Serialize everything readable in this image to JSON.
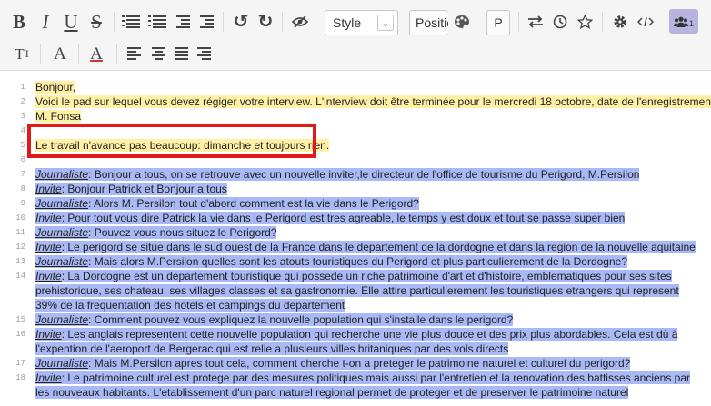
{
  "toolbar": {
    "row1": {
      "bold": "B",
      "italic": "I",
      "underline": "U",
      "strike": "S",
      "undo": "↺",
      "redo": "↻",
      "style_select": "Style",
      "style_arrow": "⌄",
      "position_select": "Positio",
      "p_button": "P",
      "users_count": "1"
    },
    "row2": {
      "clear_format": "T",
      "clear_format_mark": "I",
      "font_a": "A",
      "font_color_a": "A"
    },
    "colors": {
      "users_badge": "#b9b3df",
      "author_yellow": "#fff0a6",
      "author_blue": "#a9b9f6",
      "annotation_red": "#e11919"
    }
  },
  "editor": {
    "lines": [
      {
        "num": "1",
        "parts": [
          {
            "text": "Bonjour,"
          }
        ]
      },
      {
        "num": "2",
        "parts": [
          {
            "text": "Voici le pad sur lequel vous devez régiger votre interview. L'interview doit être terminée pour le mercredi 18 octobre, date de l'enregistrement."
          }
        ]
      },
      {
        "num": "3",
        "parts": [
          {
            "text": "M. Fonsa"
          }
        ]
      },
      {
        "num": "4",
        "parts": [
          {
            "text": ""
          }
        ]
      },
      {
        "num": "5",
        "parts": [
          {
            "text": "Le travail n'avance pas beaucoup: dimanche et toujours rien."
          }
        ]
      },
      {
        "num": "6",
        "parts": [
          {
            "text": ""
          }
        ]
      },
      {
        "num": "7",
        "speaker": "Journaliste",
        "text": ": Bonjour a tous, on se retrouve avec un nouvelle inviter,le directeur de l'office de tourisme du Perigord, M.Persilon"
      },
      {
        "num": "8",
        "speaker": "Invite",
        "text": ": Bonjour Patrick et Bonjour a tous"
      },
      {
        "num": "9",
        "speaker": "Journaliste",
        "text": ": Alors M. Persilon tout d'abord comment est la vie dans le Perigord?"
      },
      {
        "num": "10",
        "speaker": "Invite",
        "text": ": Pour tout vous dire Patrick la vie dans le Perigord est tres agreable, le temps y est doux et tout se passe super bien"
      },
      {
        "num": "11",
        "speaker": "Journaliste",
        "text": ": Pouvez vous nous situez le Perigord?"
      },
      {
        "num": "12",
        "speaker": "Invite",
        "text": ": Le perigord se situe dans le sud ouest de la France dans le departement de la dordogne et dans la region de la nouvelle aquitaine"
      },
      {
        "num": "13",
        "speaker": "Journaliste",
        "text": ": Mais alors M.Persilon quelles sont les atouts touristiques du Perigord et plus particulierement de la Dordogne?"
      },
      {
        "num": "14",
        "speaker": "Invite",
        "text": ": La Dordogne est un departement touristique qui possede un riche patrimoine d'art et d'histoire, emblematiques pour ses sites prehistorique, ses chateau, ses villages classes et sa gastronomie. Elle attire particulierement les touristiques etrangers qui represent 39% de la frequentation des hotels et campings du departement"
      },
      {
        "num": "15",
        "speaker": "Journaliste",
        "text": ": Comment pouvez vous expliquez la nouvelle population qui s'installe dans le perigord?"
      },
      {
        "num": "16",
        "speaker": "Invite",
        "text": ": Les anglais representent cette nouvelle population qui recherche une vie plus douce et des prix plus abordables. Cela est dù à l'expention de l'aeroport de Bergerac qui est relie a plusieurs villes britaniques par des vols directs"
      },
      {
        "num": "17",
        "speaker": "Journaliste",
        "text": ": Mais M.Persilon apres tout cela, comment cherche t-on a preteger le patrimoine naturel et culturel du perigord?"
      },
      {
        "num": "18",
        "speaker": "Invite",
        "text": ": Le patrimoine culturel est protege par des mesures politiques mais aussi par l'entretien et la renovation des battisses anciens par les nouveaux habitants. L'etablissement d'un parc naturel regional permet de proteger et de preserver le patrimoine naturel"
      }
    ]
  }
}
